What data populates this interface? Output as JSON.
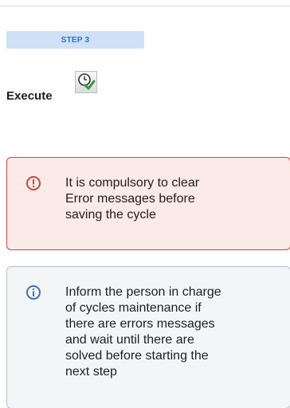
{
  "step": {
    "label": "STEP 3"
  },
  "execute": {
    "label": "Execute",
    "icon": "clock-check-icon"
  },
  "error_panel": {
    "icon": "error-icon",
    "text": "It is compulsory to clear Error messages before saving the cycle",
    "accent": "#c8483b"
  },
  "info_panel": {
    "icon": "info-icon",
    "text": "Inform the person in charge of cycles maintenance if there are errors messages and wait until there are solved before starting the next step",
    "accent": "#3b73b9"
  },
  "colors": {
    "step_badge_bg": "#cfe0f7",
    "step_badge_text": "#2f6fd1",
    "error_bg": "#fbeae7",
    "info_bg": "#f4f5f7"
  }
}
